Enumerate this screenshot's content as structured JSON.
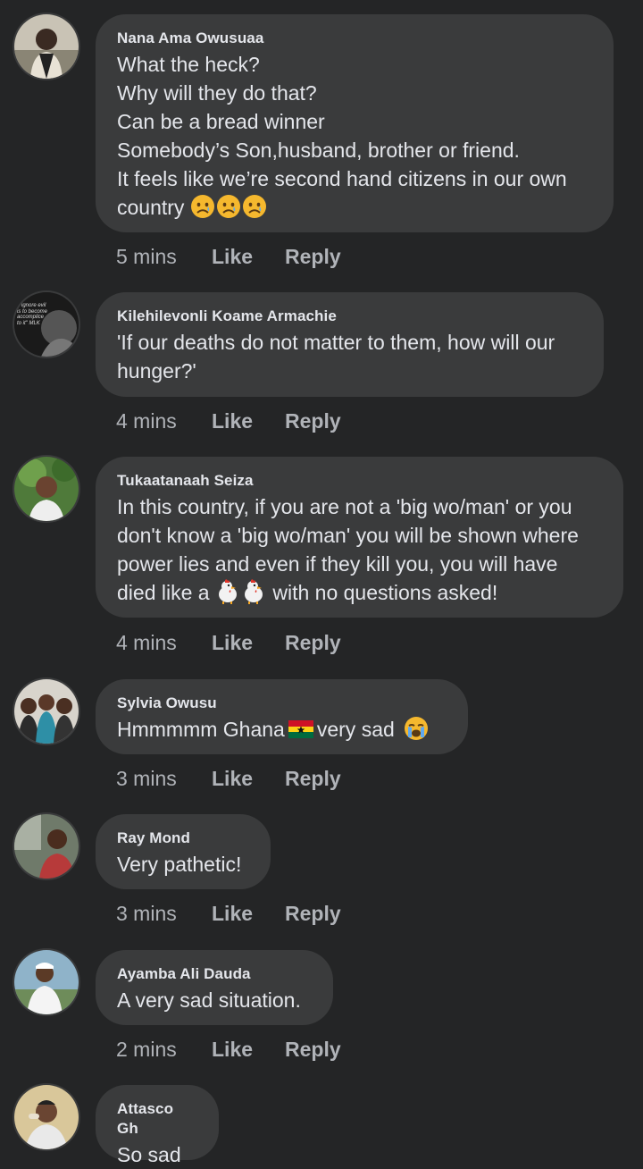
{
  "comments": [
    {
      "author": "Nana Ama Owusuaa",
      "lines": [
        "What the heck?",
        "Why will they do that?",
        "Can be a bread winner",
        "Somebody’s Son,husband, brother or friend.",
        "It feels like we’re second hand citizens in our own"
      ],
      "last_line": "country",
      "emojis": [
        "sad-face",
        "sad-face",
        "sad-face"
      ],
      "time": "5 mins",
      "like": "Like",
      "reply": "Reply"
    },
    {
      "author": "Kilehilevonli Koame Armachie",
      "lines": [
        "'If our deaths do not matter to them, how will our",
        "hunger?'"
      ],
      "avatar_text": [
        "o ignore evil",
        "is to become",
        "accomplice",
        "to it\" MLK"
      ],
      "time": "4 mins",
      "like": "Like",
      "reply": "Reply"
    },
    {
      "author": "Tukaatanaah Seiza",
      "lines": [
        "In this country, if you are not a 'big wo/man' or you",
        "don't know a 'big wo/man' you will be shown where",
        "power lies and even if they kill you, you will have"
      ],
      "last_line_a": "died like a",
      "emojis": [
        "chicken",
        "chicken"
      ],
      "last_line_b": "with no questions asked!",
      "time": "4 mins",
      "like": "Like",
      "reply": "Reply"
    },
    {
      "author": "Sylvia Owusu",
      "text_a": "Hmmmmm Ghana",
      "flag": "ghana-flag",
      "text_b": "very sad",
      "emoji": "crying-face",
      "time": "3 mins",
      "like": "Like",
      "reply": "Reply"
    },
    {
      "author": "Ray Mond",
      "lines": [
        "Very pathetic!"
      ],
      "time": "3 mins",
      "like": "Like",
      "reply": "Reply"
    },
    {
      "author": "Ayamba Ali Dauda",
      "lines": [
        "A very sad situation."
      ],
      "time": "2 mins",
      "like": "Like",
      "reply": "Reply"
    },
    {
      "author": "Attasco Gh",
      "lines": [
        "So sad"
      ]
    }
  ],
  "colors": {
    "background": "#242526",
    "bubble": "#3a3b3c",
    "text": "#e4e6eb",
    "secondary": "#b0b3b8"
  }
}
